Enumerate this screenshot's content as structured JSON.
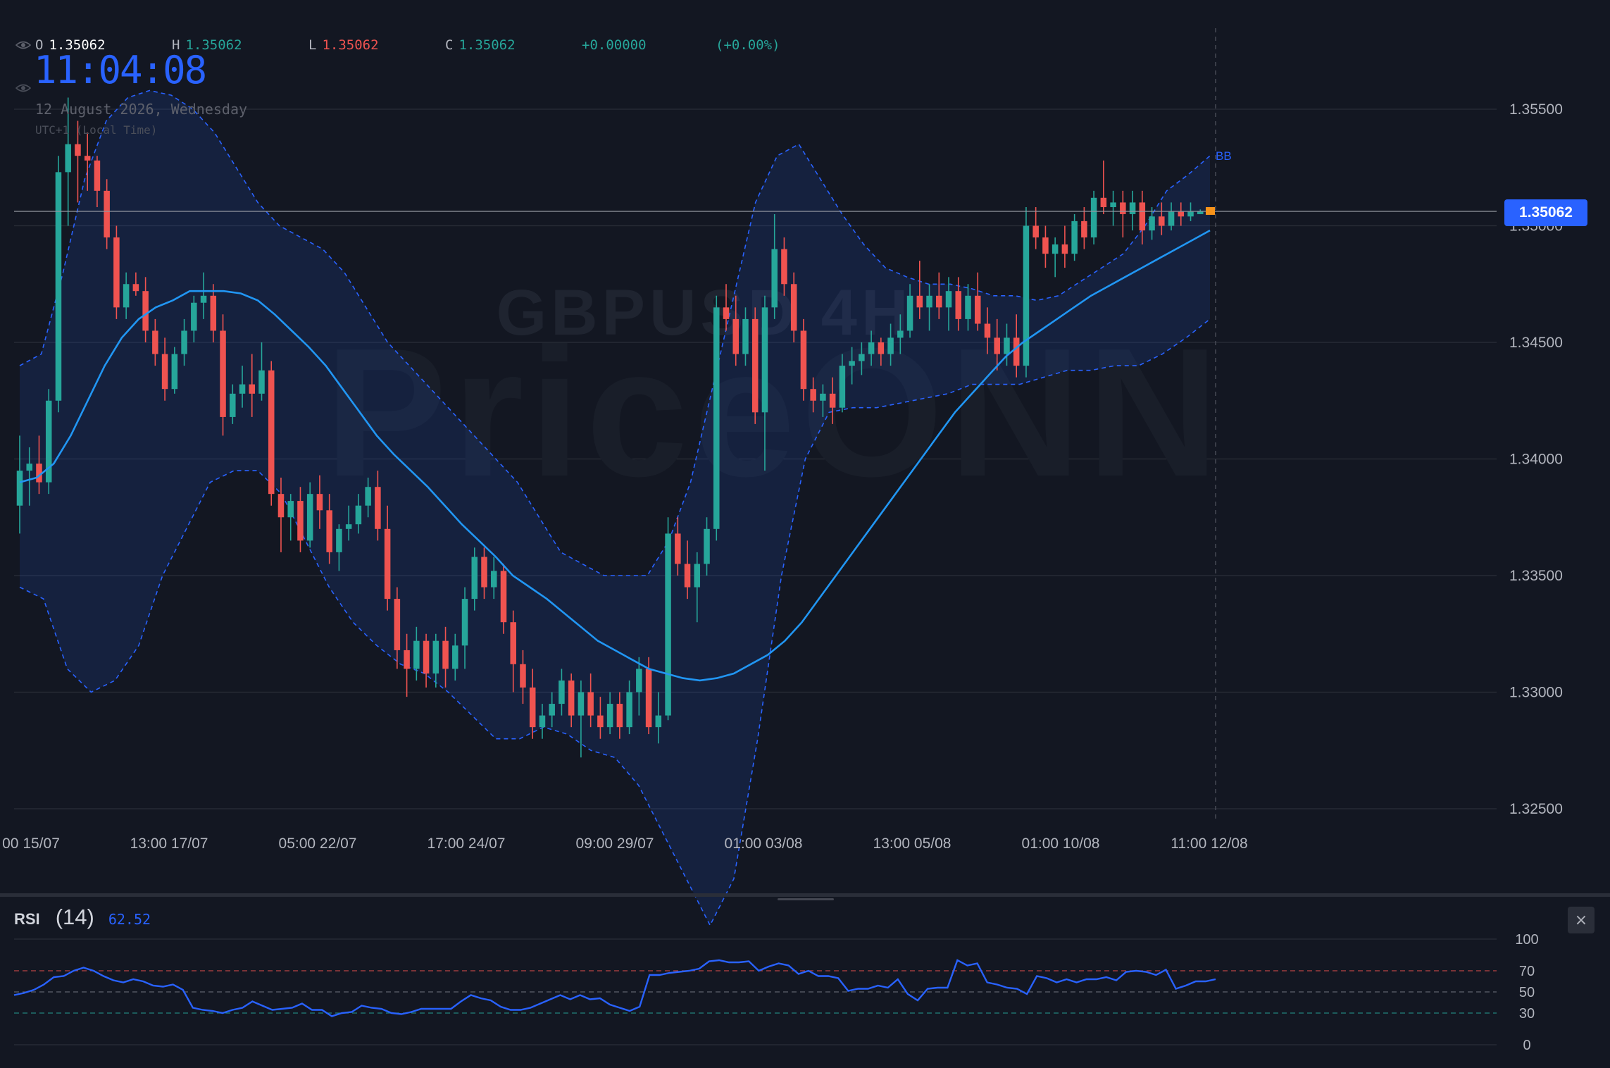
{
  "header": {
    "ohlc": [
      {
        "key": "O",
        "value": "1.35062",
        "color": "#ffffff"
      },
      {
        "key": "H",
        "value": "1.35062",
        "color": "#26a69a"
      },
      {
        "key": "L",
        "value": "1.35062",
        "color": "#ef5350"
      },
      {
        "key": "C",
        "value": "1.35062",
        "color": "#26a69a"
      }
    ],
    "change": "+0.00000",
    "change_pct": "(+0.00%)",
    "clock": "11:04:08",
    "date": "12 August 2026, Wednesday",
    "timezone": "UTC+1 (Local Time)"
  },
  "watermark": {
    "symbol_line": "GBPUSD 4H",
    "brand": "PriceONN"
  },
  "indicators": {
    "bb_label": "BB",
    "current_price": "1.35062",
    "close_icon": "close-x-icon"
  },
  "rsi": {
    "name": "RSI",
    "period": "(14)",
    "value": "62.52",
    "levels": [
      100,
      70,
      50,
      30,
      0
    ],
    "level_labels": [
      "100",
      "70",
      "50",
      "30",
      "0"
    ],
    "values": [
      47,
      49,
      52,
      57,
      64,
      65,
      70,
      73,
      70,
      65,
      61,
      59,
      62,
      60,
      56,
      55,
      57,
      52,
      35,
      33,
      32,
      30,
      33,
      35,
      41,
      37,
      33,
      34,
      35,
      39,
      33,
      33,
      27,
      30,
      31,
      37,
      35,
      34,
      30,
      29,
      31,
      34,
      34,
      34,
      34,
      41,
      47,
      44,
      42,
      36,
      33,
      33,
      35,
      39,
      43,
      47,
      43,
      47,
      43,
      44,
      38,
      35,
      32,
      36,
      66,
      66,
      68,
      69,
      70,
      72,
      79,
      80,
      78,
      78,
      79,
      70,
      74,
      77,
      75,
      67,
      70,
      65,
      65,
      63,
      51,
      53,
      53,
      56,
      54,
      62,
      48,
      42,
      53,
      54,
      54,
      80,
      75,
      77,
      59,
      57,
      54,
      53,
      48,
      65,
      63,
      59,
      62,
      59,
      62,
      62,
      64,
      61,
      69,
      70,
      69,
      66,
      71,
      53,
      56,
      60,
      60,
      62
    ]
  },
  "colors": {
    "background": "#131722",
    "up": "#26a69a",
    "down": "#ef5350",
    "basis": "#2196f3",
    "band": "#2962ff",
    "rsi_line": "#2962ff",
    "grid": "#2a2e39",
    "axis_text": "#b2b5be"
  },
  "chart_data": {
    "type": "candlestick",
    "title": "GBPUSD 4H",
    "price_axis": {
      "min": 1.3245,
      "max": 1.3575,
      "ticks": [
        1.325,
        1.33,
        1.335,
        1.34,
        1.345,
        1.35,
        1.355
      ],
      "tick_labels": [
        "1.32500",
        "1.33000",
        "1.33500",
        "1.34000",
        "1.34500",
        "1.35000",
        "1.35500"
      ]
    },
    "time_axis": {
      "tick_labels": [
        "00 15/07",
        "13:00 17/07",
        "05:00 22/07",
        "17:00 24/07",
        "09:00 29/07",
        "01:00 03/08",
        "13:00 05/08",
        "01:00 10/08",
        "11:00 12/08"
      ],
      "tick_bar_index": [
        0,
        20,
        40,
        60,
        80,
        100,
        120,
        140,
        160
      ]
    },
    "last_price": 1.35062,
    "grid": true,
    "candles_ohlc": [
      [
        1.338,
        1.341,
        1.3368,
        1.3395
      ],
      [
        1.3395,
        1.3405,
        1.338,
        1.3398
      ],
      [
        1.3398,
        1.341,
        1.3385,
        1.339
      ],
      [
        1.339,
        1.343,
        1.3385,
        1.3425
      ],
      [
        1.3425,
        1.353,
        1.342,
        1.3523
      ],
      [
        1.3523,
        1.3555,
        1.35,
        1.3535
      ],
      [
        1.3535,
        1.3545,
        1.351,
        1.353
      ],
      [
        1.353,
        1.354,
        1.3515,
        1.3528
      ],
      [
        1.3528,
        1.353,
        1.3508,
        1.3515
      ],
      [
        1.3515,
        1.352,
        1.349,
        1.3495
      ],
      [
        1.3495,
        1.35,
        1.346,
        1.3465
      ],
      [
        1.3465,
        1.348,
        1.346,
        1.3475
      ],
      [
        1.3475,
        1.348,
        1.347,
        1.3472
      ],
      [
        1.3472,
        1.3478,
        1.345,
        1.3455
      ],
      [
        1.3455,
        1.346,
        1.344,
        1.3445
      ],
      [
        1.3445,
        1.3452,
        1.3425,
        1.343
      ],
      [
        1.343,
        1.3448,
        1.3428,
        1.3445
      ],
      [
        1.3445,
        1.346,
        1.344,
        1.3455
      ],
      [
        1.3455,
        1.347,
        1.345,
        1.3467
      ],
      [
        1.3467,
        1.348,
        1.346,
        1.347
      ],
      [
        1.347,
        1.3475,
        1.345,
        1.3455
      ],
      [
        1.3455,
        1.3462,
        1.341,
        1.3418
      ],
      [
        1.3418,
        1.3432,
        1.3415,
        1.3428
      ],
      [
        1.3428,
        1.344,
        1.3422,
        1.3432
      ],
      [
        1.3432,
        1.3445,
        1.3418,
        1.3428
      ],
      [
        1.3428,
        1.345,
        1.3425,
        1.3438
      ],
      [
        1.3438,
        1.3442,
        1.338,
        1.3385
      ],
      [
        1.3385,
        1.3392,
        1.336,
        1.3375
      ],
      [
        1.3375,
        1.3385,
        1.3365,
        1.3382
      ],
      [
        1.3382,
        1.3388,
        1.336,
        1.3365
      ],
      [
        1.3365,
        1.339,
        1.3362,
        1.3385
      ],
      [
        1.3385,
        1.3393,
        1.337,
        1.3378
      ],
      [
        1.3378,
        1.3385,
        1.3355,
        1.336
      ],
      [
        1.336,
        1.3372,
        1.3352,
        1.337
      ],
      [
        1.337,
        1.338,
        1.3365,
        1.3372
      ],
      [
        1.3372,
        1.3385,
        1.3368,
        1.338
      ],
      [
        1.338,
        1.3392,
        1.3375,
        1.3388
      ],
      [
        1.3388,
        1.3395,
        1.3365,
        1.337
      ],
      [
        1.337,
        1.338,
        1.3335,
        1.334
      ],
      [
        1.334,
        1.3345,
        1.331,
        1.3318
      ],
      [
        1.3318,
        1.3325,
        1.3298,
        1.331
      ],
      [
        1.331,
        1.3328,
        1.3305,
        1.3322
      ],
      [
        1.3322,
        1.3325,
        1.3302,
        1.3308
      ],
      [
        1.3308,
        1.3325,
        1.3302,
        1.3322
      ],
      [
        1.3322,
        1.3328,
        1.3302,
        1.331
      ],
      [
        1.331,
        1.3325,
        1.3305,
        1.332
      ],
      [
        1.332,
        1.3345,
        1.331,
        1.334
      ],
      [
        1.334,
        1.3362,
        1.3335,
        1.3358
      ],
      [
        1.3358,
        1.3362,
        1.334,
        1.3345
      ],
      [
        1.3345,
        1.3358,
        1.334,
        1.3352
      ],
      [
        1.3352,
        1.3355,
        1.3325,
        1.333
      ],
      [
        1.333,
        1.3335,
        1.33,
        1.3312
      ],
      [
        1.3312,
        1.3318,
        1.3295,
        1.3302
      ],
      [
        1.3302,
        1.331,
        1.328,
        1.3285
      ],
      [
        1.3285,
        1.3295,
        1.328,
        1.329
      ],
      [
        1.329,
        1.33,
        1.3285,
        1.3295
      ],
      [
        1.3295,
        1.331,
        1.329,
        1.3305
      ],
      [
        1.3305,
        1.3308,
        1.3285,
        1.329
      ],
      [
        1.329,
        1.3305,
        1.3272,
        1.33
      ],
      [
        1.33,
        1.3308,
        1.3285,
        1.329
      ],
      [
        1.329,
        1.3298,
        1.328,
        1.3285
      ],
      [
        1.3285,
        1.33,
        1.3282,
        1.3295
      ],
      [
        1.3295,
        1.33,
        1.328,
        1.3285
      ],
      [
        1.3285,
        1.3305,
        1.3282,
        1.33
      ],
      [
        1.33,
        1.3315,
        1.329,
        1.331
      ],
      [
        1.331,
        1.3315,
        1.3282,
        1.3285
      ],
      [
        1.3285,
        1.33,
        1.3278,
        1.329
      ],
      [
        1.329,
        1.3375,
        1.3288,
        1.3368
      ],
      [
        1.3368,
        1.3375,
        1.335,
        1.3355
      ],
      [
        1.3355,
        1.3365,
        1.334,
        1.3345
      ],
      [
        1.3345,
        1.336,
        1.333,
        1.3355
      ],
      [
        1.3355,
        1.3375,
        1.335,
        1.337
      ],
      [
        1.337,
        1.347,
        1.3365,
        1.3465
      ],
      [
        1.3465,
        1.3475,
        1.3455,
        1.346
      ],
      [
        1.346,
        1.347,
        1.344,
        1.3445
      ],
      [
        1.3445,
        1.3465,
        1.344,
        1.346
      ],
      [
        1.346,
        1.3465,
        1.3415,
        1.342
      ],
      [
        1.342,
        1.347,
        1.3395,
        1.3465
      ],
      [
        1.3465,
        1.3505,
        1.346,
        1.349
      ],
      [
        1.349,
        1.3495,
        1.347,
        1.3475
      ],
      [
        1.3475,
        1.348,
        1.345,
        1.3455
      ],
      [
        1.3455,
        1.346,
        1.3425,
        1.343
      ],
      [
        1.343,
        1.3435,
        1.342,
        1.3425
      ],
      [
        1.3425,
        1.3432,
        1.3418,
        1.3428
      ],
      [
        1.3428,
        1.3435,
        1.3415,
        1.3422
      ],
      [
        1.3422,
        1.3445,
        1.342,
        1.344
      ],
      [
        1.344,
        1.3448,
        1.3432,
        1.3442
      ],
      [
        1.3442,
        1.345,
        1.3436,
        1.3445
      ],
      [
        1.3445,
        1.3455,
        1.344,
        1.345
      ],
      [
        1.345,
        1.3452,
        1.344,
        1.3445
      ],
      [
        1.3445,
        1.3458,
        1.344,
        1.3452
      ],
      [
        1.3452,
        1.3462,
        1.3445,
        1.3455
      ],
      [
        1.3455,
        1.3475,
        1.3452,
        1.347
      ],
      [
        1.347,
        1.3485,
        1.346,
        1.3465
      ],
      [
        1.3465,
        1.3475,
        1.3455,
        1.347
      ],
      [
        1.347,
        1.348,
        1.346,
        1.3465
      ],
      [
        1.3465,
        1.3478,
        1.3455,
        1.3472
      ],
      [
        1.3472,
        1.3478,
        1.3455,
        1.346
      ],
      [
        1.346,
        1.3475,
        1.3455,
        1.347
      ],
      [
        1.347,
        1.348,
        1.3455,
        1.3458
      ],
      [
        1.3458,
        1.3465,
        1.3445,
        1.3452
      ],
      [
        1.3452,
        1.346,
        1.3438,
        1.3445
      ],
      [
        1.3445,
        1.3458,
        1.344,
        1.3452
      ],
      [
        1.3452,
        1.3462,
        1.3435,
        1.344
      ],
      [
        1.344,
        1.3508,
        1.3435,
        1.35
      ],
      [
        1.35,
        1.3508,
        1.349,
        1.3495
      ],
      [
        1.3495,
        1.35,
        1.3482,
        1.3488
      ],
      [
        1.3488,
        1.3495,
        1.3478,
        1.3492
      ],
      [
        1.3492,
        1.35,
        1.3482,
        1.3488
      ],
      [
        1.3488,
        1.3505,
        1.3485,
        1.3502
      ],
      [
        1.3502,
        1.3508,
        1.349,
        1.3495
      ],
      [
        1.3495,
        1.3515,
        1.3492,
        1.3512
      ],
      [
        1.3512,
        1.3528,
        1.3505,
        1.3508
      ],
      [
        1.3508,
        1.3515,
        1.35,
        1.351
      ],
      [
        1.351,
        1.3515,
        1.3495,
        1.3505
      ],
      [
        1.3505,
        1.3515,
        1.3498,
        1.351
      ],
      [
        1.351,
        1.3515,
        1.3492,
        1.3498
      ],
      [
        1.3498,
        1.3508,
        1.3494,
        1.3504
      ],
      [
        1.3504,
        1.351,
        1.3496,
        1.35
      ],
      [
        1.35,
        1.351,
        1.3498,
        1.3506
      ],
      [
        1.3506,
        1.351,
        1.35,
        1.3504
      ],
      [
        1.3504,
        1.351,
        1.3502,
        1.3506
      ],
      [
        1.3505,
        1.3507,
        1.3505,
        1.35062
      ],
      [
        1.35062,
        1.35062,
        1.35062,
        1.35062
      ]
    ],
    "bollinger": {
      "period_label": "BB",
      "basis": [
        1.339,
        1.3392,
        1.3398,
        1.341,
        1.3425,
        1.344,
        1.3452,
        1.346,
        1.3465,
        1.3468,
        1.3472,
        1.3472,
        1.3472,
        1.3471,
        1.3468,
        1.3462,
        1.3455,
        1.3448,
        1.344,
        1.343,
        1.342,
        1.341,
        1.3402,
        1.3395,
        1.3388,
        1.338,
        1.3372,
        1.3365,
        1.3358,
        1.335,
        1.3345,
        1.334,
        1.3334,
        1.3328,
        1.3322,
        1.3318,
        1.3314,
        1.331,
        1.3308,
        1.3306,
        1.3305,
        1.3306,
        1.3308,
        1.3312,
        1.3316,
        1.3322,
        1.333,
        1.334,
        1.335,
        1.336,
        1.337,
        1.338,
        1.339,
        1.34,
        1.341,
        1.342,
        1.3428,
        1.3436,
        1.3444,
        1.345,
        1.3455,
        1.346,
        1.3465,
        1.347,
        1.3474,
        1.3478,
        1.3482,
        1.3486,
        1.349,
        1.3494,
        1.3498
      ],
      "upper": [
        1.344,
        1.3445,
        1.348,
        1.352,
        1.3545,
        1.3555,
        1.3558,
        1.3556,
        1.355,
        1.354,
        1.3525,
        1.351,
        1.35,
        1.3495,
        1.349,
        1.348,
        1.3465,
        1.345,
        1.344,
        1.343,
        1.342,
        1.341,
        1.34,
        1.339,
        1.3375,
        1.336,
        1.3355,
        1.335,
        1.335,
        1.335,
        1.3365,
        1.339,
        1.343,
        1.347,
        1.351,
        1.353,
        1.3535,
        1.352,
        1.3505,
        1.3492,
        1.3482,
        1.3478,
        1.3475,
        1.3475,
        1.3473,
        1.347,
        1.347,
        1.3468,
        1.347,
        1.3476,
        1.3482,
        1.3488,
        1.35,
        1.3515,
        1.3522,
        1.353
      ],
      "lower": [
        1.3345,
        1.334,
        1.331,
        1.33,
        1.3305,
        1.332,
        1.335,
        1.337,
        1.339,
        1.3395,
        1.3395,
        1.3385,
        1.3365,
        1.3345,
        1.333,
        1.332,
        1.3312,
        1.3308,
        1.33,
        1.329,
        1.328,
        1.328,
        1.3285,
        1.3282,
        1.3275,
        1.3272,
        1.326,
        1.324,
        1.322,
        1.32,
        1.322,
        1.328,
        1.335,
        1.34,
        1.342,
        1.3422,
        1.3422,
        1.3424,
        1.3426,
        1.3428,
        1.3432,
        1.3432,
        1.3432,
        1.3435,
        1.3438,
        1.3438,
        1.344,
        1.344,
        1.3445,
        1.3452,
        1.346
      ]
    }
  }
}
